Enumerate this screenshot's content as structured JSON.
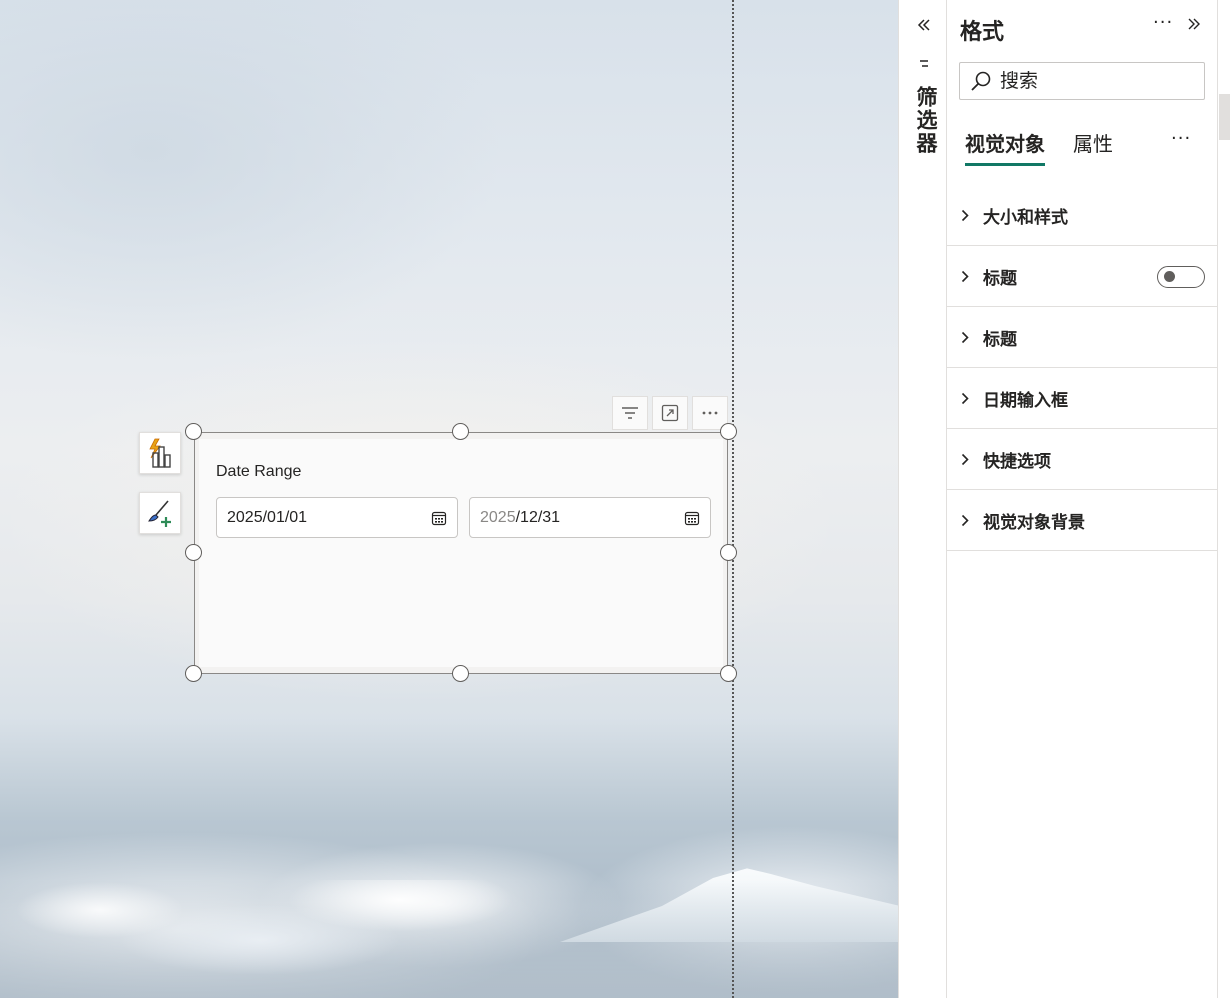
{
  "canvas": {
    "visual": {
      "title": "Date Range",
      "start_date": {
        "muted": "",
        "value": "2025/01/01"
      },
      "end_date": {
        "muted": "2025",
        "value": "/12/31"
      }
    }
  },
  "filters_pane": {
    "label": "筛选器"
  },
  "format_pane": {
    "title": "格式",
    "more": "···",
    "search": {
      "placeholder": "搜索",
      "value": ""
    },
    "tabs": [
      {
        "label": "视觉对象",
        "active": true
      },
      {
        "label": "属性",
        "active": false
      }
    ],
    "tabs_more": "···",
    "sections": [
      {
        "label": "大小和样式"
      },
      {
        "label": "标题",
        "toggle": "off"
      },
      {
        "label": "标题"
      },
      {
        "label": "日期输入框"
      },
      {
        "label": "快捷选项"
      },
      {
        "label": "视觉对象背景"
      }
    ]
  },
  "colors": {
    "accent": "#117865",
    "border": "#e1dfdd",
    "text": "#252423"
  }
}
